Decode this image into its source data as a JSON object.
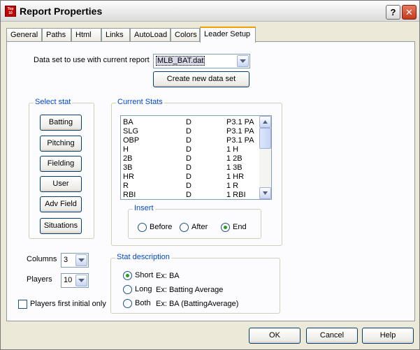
{
  "window": {
    "title": "Report Properties",
    "icon_text": "Top 10",
    "help_label": "?",
    "close_label": "✕"
  },
  "tabs": [
    {
      "label": "General",
      "active": false
    },
    {
      "label": "Paths",
      "active": false
    },
    {
      "label": "Html",
      "active": false
    },
    {
      "label": "Links",
      "active": false
    },
    {
      "label": "AutoLoad",
      "active": false
    },
    {
      "label": "Colors",
      "active": false
    },
    {
      "label": "Leader Setup",
      "active": true
    }
  ],
  "data_set": {
    "label": "Data set to use with current report",
    "value": "MLB_BAT.dat",
    "create_button": "Create new data set"
  },
  "select_stat": {
    "title": "Select stat",
    "buttons": [
      "Batting",
      "Pitching",
      "Fielding",
      "User",
      "Adv Field",
      "Situations"
    ]
  },
  "current_stats": {
    "title": "Current Stats",
    "rows": [
      {
        "name": "BA",
        "type": "D",
        "fmt": "P3.1 PA"
      },
      {
        "name": "SLG",
        "type": "D",
        "fmt": "P3.1 PA"
      },
      {
        "name": "OBP",
        "type": "D",
        "fmt": "P3.1 PA"
      },
      {
        "name": "H",
        "type": "D",
        "fmt": "1 H"
      },
      {
        "name": "2B",
        "type": "D",
        "fmt": "1 2B"
      },
      {
        "name": "3B",
        "type": "D",
        "fmt": "1 3B"
      },
      {
        "name": "HR",
        "type": "D",
        "fmt": "1 HR"
      },
      {
        "name": "R",
        "type": "D",
        "fmt": "1 R"
      },
      {
        "name": "RBI",
        "type": "D",
        "fmt": "1 RBI"
      }
    ]
  },
  "insert": {
    "title": "Insert",
    "options": [
      "Before",
      "After",
      "End"
    ],
    "selected": "End"
  },
  "columns": {
    "label": "Columns",
    "value": "3"
  },
  "players": {
    "label": "Players",
    "value": "10"
  },
  "first_initial": {
    "label": "Players first initial only",
    "checked": false
  },
  "stat_description": {
    "title": "Stat description",
    "options": [
      {
        "label": "Short",
        "example": "Ex:   BA"
      },
      {
        "label": "Long",
        "example": "Ex:   Batting Average"
      },
      {
        "label": "Both",
        "example": "Ex:   BA (BattingAverage)"
      }
    ],
    "selected": "Short"
  },
  "footer": {
    "ok": "OK",
    "cancel": "Cancel",
    "help": "Help"
  },
  "colors": {
    "accent_tab": "#f0a000",
    "group_title": "#0046d5",
    "radio_dot": "#21a121"
  }
}
